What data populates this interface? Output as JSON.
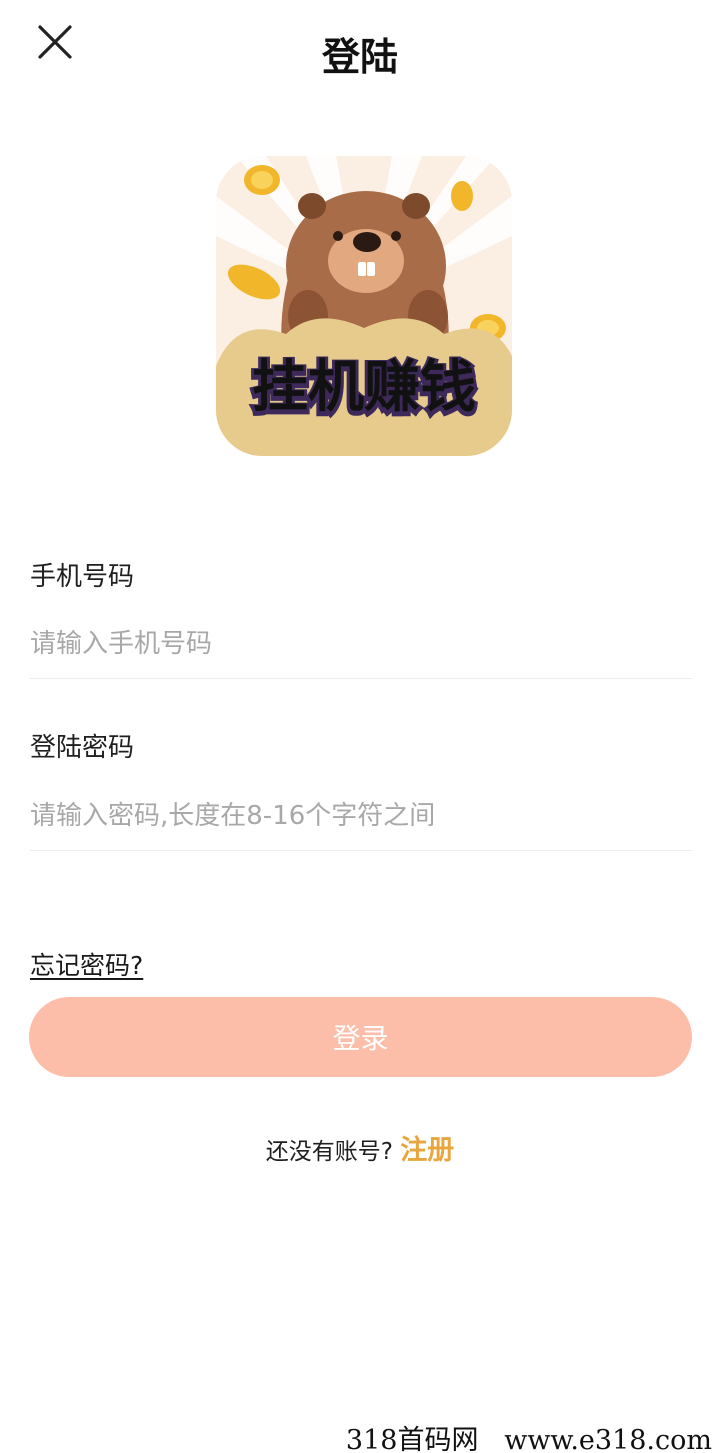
{
  "header": {
    "title": "登陆",
    "close_icon": "close-icon"
  },
  "logo": {
    "text": "挂机赚钱",
    "icon": "beaver-mascot-logo"
  },
  "form": {
    "phone": {
      "label": "手机号码",
      "placeholder": "请输入手机号码",
      "value": ""
    },
    "password": {
      "label": "登陆密码",
      "placeholder": "请输入密码,长度在8-16个字符之间",
      "value": ""
    },
    "forgot_password": "忘记密码?",
    "login_button": "登录"
  },
  "register": {
    "prompt": "还没有账号?",
    "link": "注册"
  },
  "watermark": {
    "left": "318首码网",
    "right": "www.e318.com"
  },
  "colors": {
    "button_bg": "#fdbea9",
    "link": "#e9a63f",
    "placeholder": "#a8a8a8",
    "divider": "#ececec"
  }
}
